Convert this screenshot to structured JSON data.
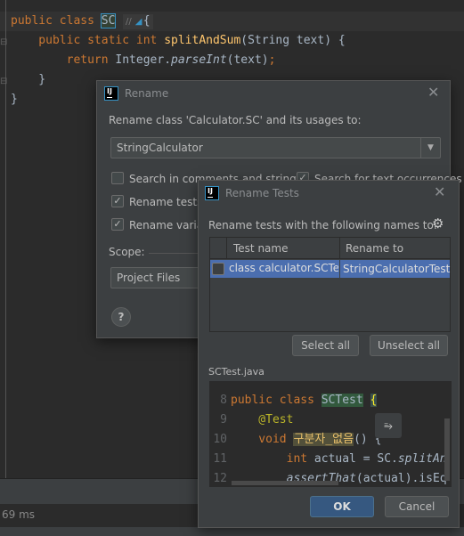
{
  "editor": {
    "lines": [
      {
        "parts": [
          {
            "t": "public class ",
            "c": "kw"
          },
          {
            "t": "SC",
            "c": "sel"
          },
          {
            "t": "    {",
            "c": ""
          }
        ]
      },
      {
        "parts": [
          {
            "t": "    public static int ",
            "c": "kw"
          },
          {
            "t": "splitAndSum",
            "c": "fn"
          },
          {
            "t": "(String text) {",
            "c": ""
          }
        ]
      },
      {
        "parts": [
          {
            "t": "        return ",
            "c": "kw"
          },
          {
            "t": "Integer.",
            "c": ""
          },
          {
            "t": "parseInt",
            "c": "it"
          },
          {
            "t": "(text)",
            "c": ""
          },
          {
            "t": ";",
            "c": "kw"
          }
        ]
      },
      {
        "parts": [
          {
            "t": "    }",
            "c": ""
          }
        ]
      },
      {
        "parts": [
          {
            "t": "}",
            "c": ""
          }
        ]
      }
    ],
    "status_time": "69 ms"
  },
  "rename": {
    "title": "Rename",
    "prompt": "Rename class 'Calculator.SC' and its usages to:",
    "new_name": "StringCalculator",
    "options": [
      {
        "label": "Search in comments and strings",
        "checked": false
      },
      {
        "label": "Search for text occurrences",
        "checked": true
      },
      {
        "label": "Rename tests",
        "checked": true
      },
      {
        "label": "Rename variables",
        "checked": true
      }
    ],
    "scope_label": "Scope:",
    "scope_value": "Project Files",
    "help": "?"
  },
  "rename_tests": {
    "title": "Rename Tests",
    "prompt": "Rename tests with the following names to:",
    "columns": [
      "Test name",
      "Rename to"
    ],
    "rows": [
      {
        "checked": false,
        "test_name": "class calculator.SCTest",
        "rename_to": "StringCalculatorTest"
      }
    ],
    "select_all": "Select all",
    "unselect_all": "Unselect all",
    "preview_file": "SCTest.java",
    "preview_lines": [
      {
        "num": "8",
        "parts": [
          {
            "t": "public class ",
            "c": "kw"
          },
          {
            "t": "SCTest",
            "c": "hl-green"
          },
          {
            "t": " ",
            "c": ""
          },
          {
            "t": "{",
            "c": "brace"
          }
        ]
      },
      {
        "num": "9",
        "parts": [
          {
            "t": "    @Test",
            "c": "ann"
          }
        ]
      },
      {
        "num": "10",
        "parts": [
          {
            "t": "    void ",
            "c": "kw"
          },
          {
            "t": "구분자_없음",
            "c": "hl-yellow"
          },
          {
            "t": "() {",
            "c": ""
          }
        ]
      },
      {
        "num": "11",
        "parts": [
          {
            "t": "        int ",
            "c": "kw"
          },
          {
            "t": "actual = SC.",
            "c": ""
          },
          {
            "t": "splitAn",
            "c": "it"
          }
        ]
      },
      {
        "num": "12",
        "parts": [
          {
            "t": "        ",
            "c": ""
          },
          {
            "t": "assertThat",
            "c": "it"
          },
          {
            "t": "(actual).isEq",
            "c": ""
          }
        ]
      }
    ],
    "ok": "OK",
    "cancel": "Cancel"
  },
  "colors": {
    "accent": "#4b6eaf",
    "ok_button": "#365880",
    "keyword": "#cc7832"
  }
}
